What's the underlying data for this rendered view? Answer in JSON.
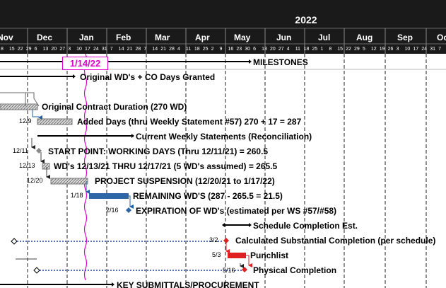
{
  "header": {
    "year": "2022",
    "months": [
      "Nov",
      "Dec",
      "Jan",
      "Feb",
      "Mar",
      "Apr",
      "May",
      "Jun",
      "Jul",
      "Aug",
      "Sep",
      "Oct"
    ],
    "days": [
      "8",
      "15",
      "22",
      "29",
      "6",
      "13",
      "20",
      "27",
      "3",
      "10",
      "17",
      "24",
      "31",
      "7",
      "14",
      "21",
      "28",
      "7",
      "14",
      "21",
      "28",
      "4",
      "11",
      "18",
      "25",
      "2",
      "9",
      "16",
      "23",
      "30",
      "6",
      "13",
      "20",
      "27",
      "4",
      "11",
      "18",
      "25",
      "1",
      "8",
      "15",
      "22",
      "29",
      "5",
      "12",
      "19",
      "26",
      "3",
      "10",
      "17",
      "24",
      "31",
      "7"
    ]
  },
  "today_marker": "1/14/22",
  "tasks": [
    {
      "id": "milestones",
      "label": "MILESTONES"
    },
    {
      "id": "original-wds",
      "label": "Original WD's + CO Days Granted"
    },
    {
      "id": "original-contract",
      "label": "Original Contract Duration (270 WD)"
    },
    {
      "id": "added-days",
      "label": "Added Days (thru Weekly Statement #57) 270 + 17 = 287",
      "date": "12/9"
    },
    {
      "id": "current-weekly",
      "label": "Current Weekly Statements (Reconciliation)"
    },
    {
      "id": "start-point",
      "label": "START POINT: WORKING DAYS (Thru 12/11/21) = 260.5",
      "date": "12/11"
    },
    {
      "id": "wds-1213",
      "label": "WD's 12/13/21 THRU 12/17/21 (5 WD's assumed) = 265.5",
      "date": "12/13"
    },
    {
      "id": "suspension",
      "label": "PROJECT SUSPENSION (12/20/21 to 1/17/22)",
      "date": "12/20"
    },
    {
      "id": "remaining",
      "label": "REMAINING WD'S (287 - 265.5 = 21.5)",
      "date": "1/18"
    },
    {
      "id": "expiration",
      "label": "EXPIRATION OF WD's (estimated per WS #57/#58)",
      "date": "2/16"
    },
    {
      "id": "schedule-completion",
      "label": "Schedule Completion Est."
    },
    {
      "id": "calc-substantial",
      "label": "Calculated Substantial Completion (per schedule)",
      "date": "3/2"
    },
    {
      "id": "punchlist",
      "label": "Punchlist",
      "date": "5/3"
    },
    {
      "id": "physical",
      "label": "Physical Completion",
      "date": "5/16"
    },
    {
      "id": "key-submittals",
      "label": "KEY SUBMITTALS/PROCUREMENT"
    }
  ],
  "colors": {
    "header_bg": "#1a1a1a",
    "today_line": "#e000d0",
    "remaining_bar": "#2e66a8",
    "critical": "#e02020",
    "summary": "#000000",
    "arrow": "#1f5fa8"
  }
}
